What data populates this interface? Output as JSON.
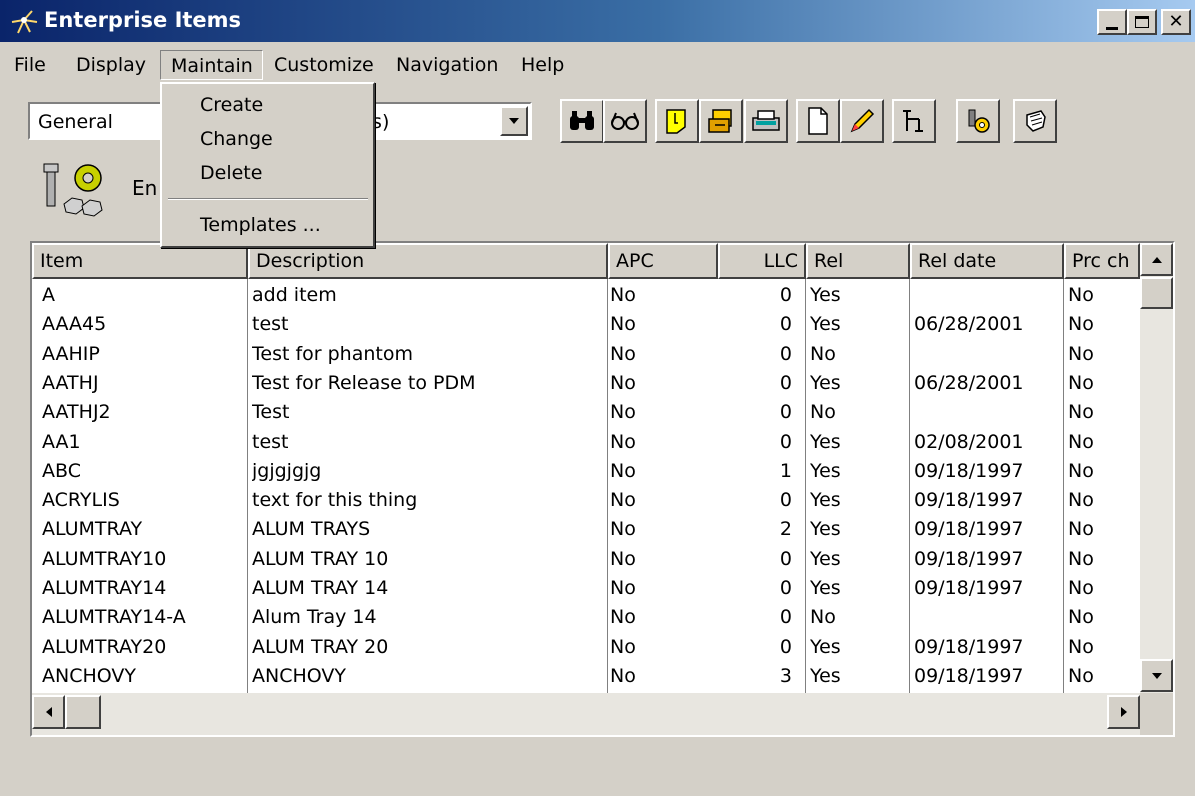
{
  "window": {
    "title": "Enterprise Items",
    "controls": [
      "minimize-icon",
      "maximize-icon",
      "close-icon"
    ]
  },
  "menubar": {
    "items": [
      "File",
      "Display",
      "Maintain",
      "Customize",
      "Navigation",
      "Help"
    ]
  },
  "maintain_menu": {
    "items": [
      "Create",
      "Change",
      "Delete",
      "Templates ..."
    ]
  },
  "view_combo": {
    "value": "General",
    "value_tail": "ds)"
  },
  "toolbar": {
    "buttons": [
      "binoculars-icon",
      "glasses-icon",
      "note-icon",
      "edit-form-icon",
      "print-icon",
      "new-document-icon",
      "pencil-icon",
      "tree-icon",
      "bolt-nut-icon",
      "hand-icon"
    ]
  },
  "entity": {
    "label": "En"
  },
  "grid": {
    "columns": [
      "Item",
      "Description",
      "APC",
      "LLC",
      "Rel",
      "Rel date",
      "Prc ch"
    ],
    "rows": [
      [
        "A",
        "add item",
        "No",
        "0",
        "Yes",
        "",
        "No"
      ],
      [
        "AAA45",
        "test",
        "No",
        "0",
        "Yes",
        "06/28/2001",
        "No"
      ],
      [
        "AAHIP",
        "Test for phantom",
        "No",
        "0",
        "No",
        "",
        "No"
      ],
      [
        "AATHJ",
        "Test for Release to PDM",
        "No",
        "0",
        "Yes",
        "06/28/2001",
        "No"
      ],
      [
        "AATHJ2",
        "Test",
        "No",
        "0",
        "No",
        "",
        "No"
      ],
      [
        "AA1",
        "test",
        "No",
        "0",
        "Yes",
        "02/08/2001",
        "No"
      ],
      [
        "ABC",
        "jgjgjgjg",
        "No",
        "1",
        "Yes",
        "09/18/1997",
        "No"
      ],
      [
        "ACRYLIS",
        "text for this thing",
        "No",
        "0",
        "Yes",
        "09/18/1997",
        "No"
      ],
      [
        "ALUMTRAY",
        "ALUM TRAYS",
        "No",
        "2",
        "Yes",
        "09/18/1997",
        "No"
      ],
      [
        "ALUMTRAY10",
        "ALUM TRAY 10",
        "No",
        "0",
        "Yes",
        "09/18/1997",
        "No"
      ],
      [
        "ALUMTRAY14",
        "ALUM TRAY  14",
        "No",
        "0",
        "Yes",
        "09/18/1997",
        "No"
      ],
      [
        "ALUMTRAY14-A",
        "Alum Tray  14",
        "No",
        "0",
        "No",
        "",
        "No"
      ],
      [
        "ALUMTRAY20",
        "ALUM TRAY 20",
        "No",
        "0",
        "Yes",
        "09/18/1997",
        "No"
      ],
      [
        "ANCHOVY",
        "ANCHOVY",
        "No",
        "3",
        "Yes",
        "09/18/1997",
        "No"
      ]
    ]
  },
  "colors": {
    "title_start": "#0a246a",
    "title_end": "#a6caf0",
    "face": "#d4d0c8"
  }
}
